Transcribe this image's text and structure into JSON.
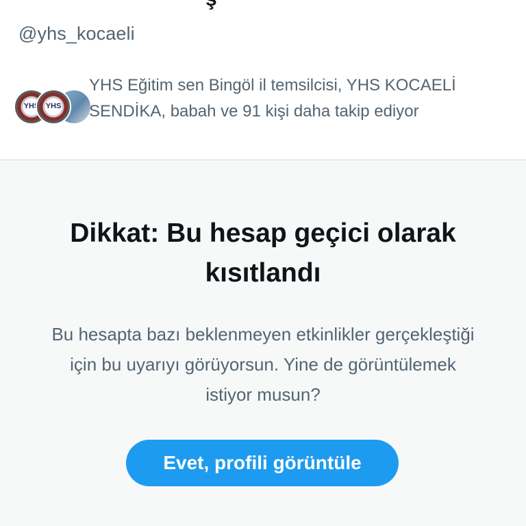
{
  "header": {
    "display_name_partial": "ş",
    "handle": "@yhs_kocaeli"
  },
  "followers_you_know": {
    "avatars": [
      {
        "label": "YHS"
      },
      {
        "label": "YHS"
      },
      {
        "label": ""
      }
    ],
    "text": "YHS Eğitim sen Bingöl il temsilcisi, YHS KOCAELİ SENDİKA, babah ve 91 kişi daha takip ediyor"
  },
  "notice": {
    "title": "Dikkat: Bu hesap geçici olarak kısıtlandı",
    "body": "Bu hesapta bazı beklenmeyen etkinlikler gerçekleştiği için bu uyarıyı görüyorsun. Yine de görüntülemek istiyor musun?",
    "button_label": "Evet, profili görüntüle"
  },
  "colors": {
    "accent": "#1d9bf0",
    "text_primary": "#0f1419",
    "text_secondary": "#536471",
    "notice_bg": "#f7f9f9"
  }
}
